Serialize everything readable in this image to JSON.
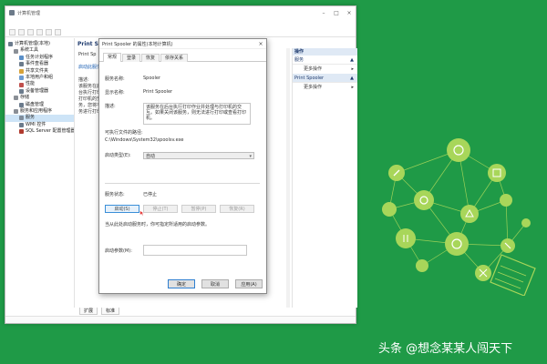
{
  "mmc": {
    "title": "计算机管理",
    "tree": [
      {
        "label": "计算机管理(本地)",
        "indent": 0,
        "color": "#6b7b8c"
      },
      {
        "label": "系统工具",
        "indent": 1,
        "color": "#8a8f96"
      },
      {
        "label": "任务计划程序",
        "indent": 2,
        "color": "#5a8fc7"
      },
      {
        "label": "事件查看器",
        "indent": 2,
        "color": "#6b7b8c"
      },
      {
        "label": "共享文件夹",
        "indent": 2,
        "color": "#d6a23a"
      },
      {
        "label": "本地用户和组",
        "indent": 2,
        "color": "#6b9bd2"
      },
      {
        "label": "性能",
        "indent": 2,
        "color": "#c0504d"
      },
      {
        "label": "设备管理器",
        "indent": 2,
        "color": "#6b7b8c"
      },
      {
        "label": "存储",
        "indent": 1,
        "color": "#8a8f96"
      },
      {
        "label": "磁盘管理",
        "indent": 2,
        "color": "#6b7b8c"
      },
      {
        "label": "服务和应用程序",
        "indent": 1,
        "color": "#8a8f96"
      },
      {
        "label": "服务",
        "indent": 2,
        "color": "#7f8c9a",
        "selected": true
      },
      {
        "label": "WMI 控件",
        "indent": 2,
        "color": "#6b7b8c"
      },
      {
        "label": "SQL Server 配置管理器",
        "indent": 2,
        "color": "#b03a2e"
      }
    ],
    "center": {
      "header": "Print Spo",
      "lines": [
        "Print Sp",
        "",
        "启动此服务",
        "",
        "描述:",
        "该服务在后",
        "台执行打印",
        "打印机的交",
        "务，您将不",
        "务进行打印"
      ]
    },
    "actions": {
      "header": "操作",
      "sections": [
        {
          "title": "服务",
          "item": "更多操作"
        },
        {
          "title": "Print Spooler",
          "item": "更多操作"
        }
      ]
    },
    "bottom_tabs": [
      "扩展",
      "标准"
    ]
  },
  "dialog": {
    "title": "Print Spooler 的属性(本地计算机)",
    "tabs": [
      "常规",
      "登录",
      "恢复",
      "依存关系"
    ],
    "service_name_label": "服务名称:",
    "service_name": "Spooler",
    "display_name_label": "显示名称:",
    "display_name": "Print Spooler",
    "description_label": "描述:",
    "description": "该服务在后台执行打印作业并处理与打印机的交互。如果关闭该服务，则无法进行打印或查看打印机。",
    "exe_path_label": "可执行文件的路径:",
    "exe_path": "C:\\Windows\\System32\\spoolsv.exe",
    "startup_type_label": "启动类型(E):",
    "startup_type": "自动",
    "status_label": "服务状态:",
    "status": "已停止",
    "buttons": {
      "start": "启动(S)",
      "stop": "停止(T)",
      "pause": "暂停(P)",
      "resume": "恢复(R)"
    },
    "hint": "当从此处启动服务时，你可指定所适用的启动参数。",
    "params_label": "启动参数(M):",
    "params_value": "",
    "ok": "确定",
    "cancel": "取消",
    "apply": "应用(A)"
  },
  "watermark": "头条 @想念某某人闯天下",
  "colors": {
    "background": "#1f9a47",
    "deco_light": "#a8d65a",
    "deco_white": "#ffffff"
  }
}
